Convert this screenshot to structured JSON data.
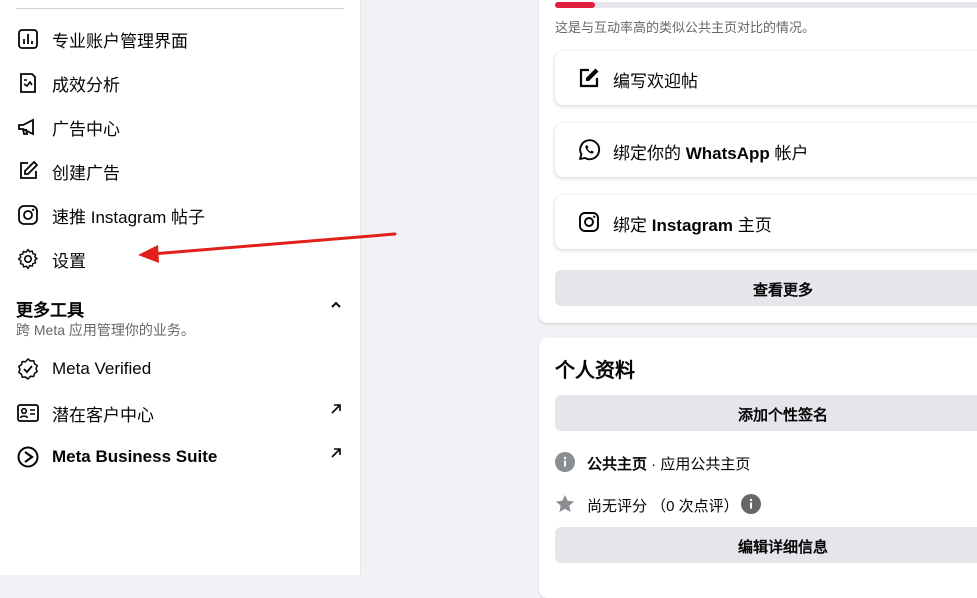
{
  "sidebar": {
    "items": [
      {
        "label": "专业账户管理界面",
        "icon": "dashboard-chart-icon"
      },
      {
        "label": "成效分析",
        "icon": "insights-icon"
      },
      {
        "label": "广告中心",
        "icon": "megaphone-icon"
      },
      {
        "label": "创建广告",
        "icon": "edit-icon"
      },
      {
        "label": "速推 Instagram 帖子",
        "icon": "instagram-icon"
      },
      {
        "label": "设置",
        "icon": "gear-icon"
      }
    ],
    "more_tools": {
      "title": "更多工具",
      "subtitle": "跨 Meta 应用管理你的业务。",
      "items": [
        {
          "label": "Meta Verified",
          "icon": "verified-badge-icon"
        },
        {
          "label": "潜在客户中心",
          "icon": "contact-card-icon"
        },
        {
          "label": "Meta Business Suite",
          "icon": "meta-business-suite-icon"
        }
      ]
    }
  },
  "main": {
    "progress_fraction": 0.09,
    "comparison_note": "这是与互动率高的类似公共主页对比的情况。",
    "actions": [
      {
        "label": "编写欢迎帖",
        "icon": "compose-icon"
      },
      {
        "label_pre": "绑定你的 ",
        "label_bold": "WhatsApp",
        "label_post": " 帐户",
        "icon": "whatsapp-icon"
      },
      {
        "label_pre": "绑定 ",
        "label_bold": "Instagram",
        "label_post": " 主页",
        "icon": "instagram-icon"
      }
    ],
    "see_more": "查看更多",
    "profile": {
      "title": "个人资料",
      "add_bio": "添加个性签名",
      "page_label": "公共主页",
      "page_type": " · 应用公共主页",
      "rating": "尚无评分 （0 次点评）",
      "edit_details": "编辑详细信息"
    }
  },
  "colors": {
    "accent_red": "#e41e3f",
    "annotation_arrow": "#e0201b"
  }
}
